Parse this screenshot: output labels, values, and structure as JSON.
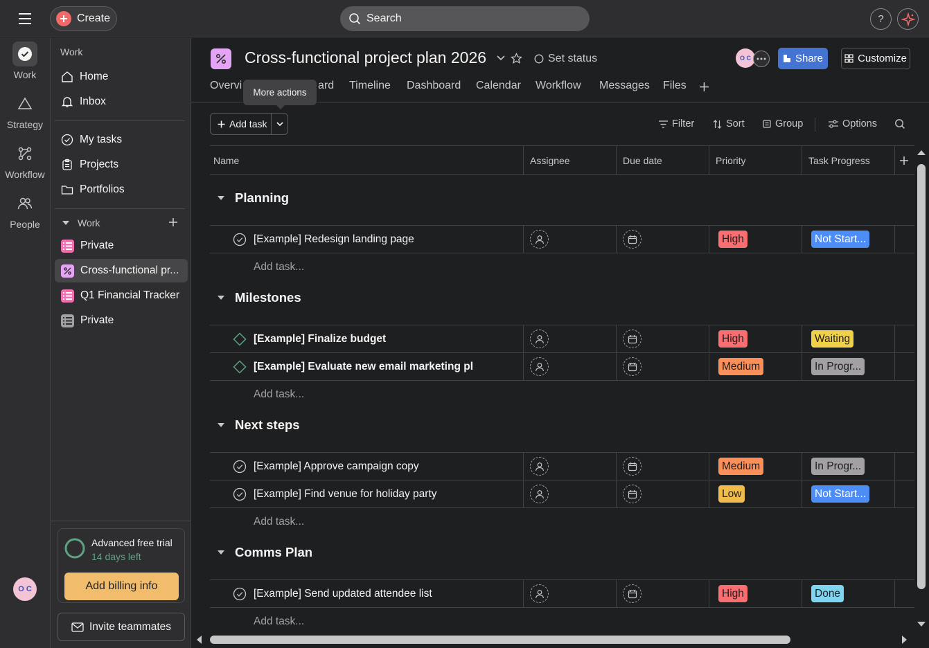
{
  "topbar": {
    "create_label": "Create",
    "search_placeholder": "Search",
    "help_label": "?"
  },
  "rail": {
    "items": [
      {
        "label": "Work",
        "icon": "check-circle-icon"
      },
      {
        "label": "Strategy",
        "icon": "triangle-icon"
      },
      {
        "label": "Workflow",
        "icon": "workflow-icon"
      },
      {
        "label": "People",
        "icon": "people-icon"
      }
    ],
    "avatar_initials": "O C"
  },
  "sidebar": {
    "heading": "Work",
    "nav": [
      {
        "label": "Home",
        "icon": "home-icon"
      },
      {
        "label": "Inbox",
        "icon": "bell-icon"
      }
    ],
    "nav2": [
      {
        "label": "My tasks",
        "icon": "check-circle-icon"
      },
      {
        "label": "Projects",
        "icon": "clipboard-icon"
      },
      {
        "label": "Portfolios",
        "icon": "folder-icon"
      }
    ],
    "section_label": "Work",
    "projects": [
      {
        "label": "Private",
        "color": "#f26fb2",
        "icon": "list-icon"
      },
      {
        "label": "Cross-functional pr...",
        "color": "#e5a3f5",
        "icon": "percent-icon",
        "active": true
      },
      {
        "label": "Q1 Financial Tracker",
        "color": "#f26fb2",
        "icon": "list-icon"
      },
      {
        "label": "Private",
        "color": "#a2a0a2",
        "icon": "list-icon"
      }
    ],
    "trial": {
      "title": "Advanced free trial",
      "days_left": "14 days left",
      "billing_label": "Add billing info"
    },
    "invite_label": "Invite teammates"
  },
  "project": {
    "title": "Cross-functional project plan 2026",
    "set_status": "Set status",
    "share_label": "Share",
    "customize_label": "Customize",
    "avatar_initials": "O C",
    "tabs": [
      "Overvi",
      "ard",
      "Timeline",
      "Dashboard",
      "Calendar",
      "Workflow",
      "Messages",
      "Files"
    ],
    "tooltip": "More actions"
  },
  "toolbar": {
    "add_task": "Add task",
    "filter": "Filter",
    "sort": "Sort",
    "group": "Group",
    "options": "Options"
  },
  "table": {
    "columns": [
      "Name",
      "Assignee",
      "Due date",
      "Priority",
      "Task Progress"
    ],
    "add_task_label": "Add task...",
    "sections": [
      {
        "title": "Planning",
        "tasks": [
          {
            "name": "[Example] Redesign landing page",
            "type": "task",
            "priority": "High",
            "progress": "Not Start..."
          }
        ]
      },
      {
        "title": "Milestones",
        "tasks": [
          {
            "name": "[Example] Finalize budget",
            "type": "milestone",
            "priority": "High",
            "progress": "Waiting"
          },
          {
            "name": "[Example] Evaluate new email marketing pl",
            "type": "milestone",
            "priority": "Medium",
            "progress": "In Progr..."
          }
        ]
      },
      {
        "title": "Next steps",
        "tasks": [
          {
            "name": "[Example] Approve campaign copy",
            "type": "task",
            "priority": "Medium",
            "progress": "In Progr..."
          },
          {
            "name": "[Example] Find venue for holiday party",
            "type": "task",
            "priority": "Low",
            "progress": "Not Start..."
          }
        ]
      },
      {
        "title": "Comms Plan",
        "tasks": [
          {
            "name": "[Example] Send updated attendee list",
            "type": "task",
            "priority": "High",
            "progress": "Done"
          }
        ]
      }
    ]
  },
  "colors": {
    "priority_high": "#f96e6e",
    "priority_medium": "#fb8f5a",
    "priority_low": "#f1bd4a",
    "progress_not_started": "#4c8df6",
    "progress_waiting": "#f1d14a",
    "progress_in_progress": "#a2a0a2",
    "progress_done": "#7fd4f0"
  }
}
